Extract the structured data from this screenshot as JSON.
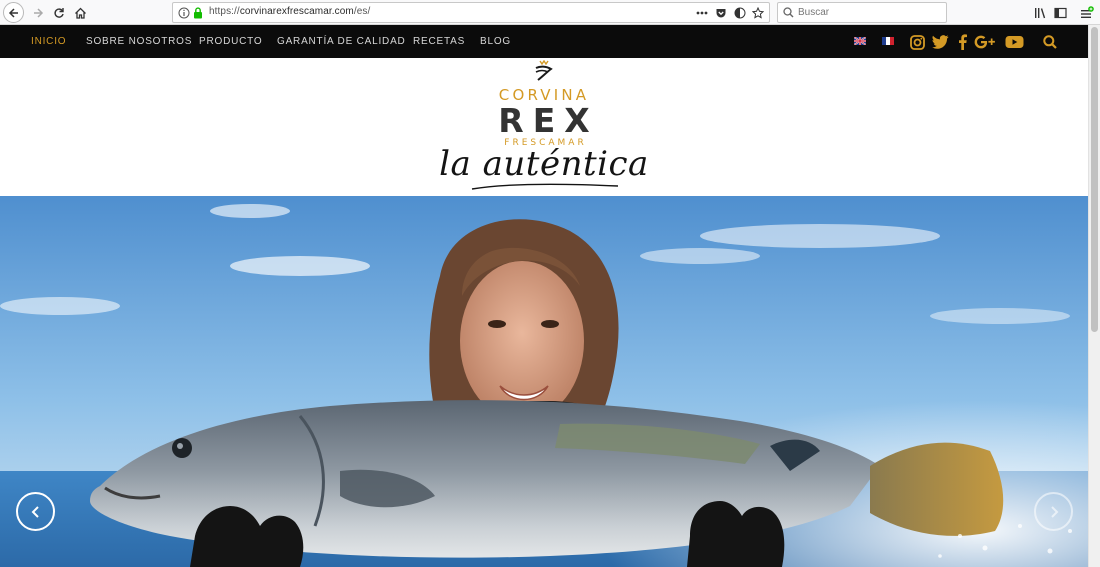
{
  "browser": {
    "url_scheme": "https://",
    "url_host": "corvinarexfrescamar.com",
    "url_path": "/es/",
    "search_placeholder": "Buscar"
  },
  "nav": {
    "items": [
      {
        "label": "INICIO",
        "active": true
      },
      {
        "label": "SOBRE NOSOTROS",
        "active": false
      },
      {
        "label": "PRODUCTO",
        "active": false
      },
      {
        "label": "GARANTÍA DE CALIDAD",
        "active": false
      },
      {
        "label": "RECETAS",
        "active": false
      },
      {
        "label": "BLOG",
        "active": false
      }
    ],
    "languages": [
      "english-flag",
      "french-flag"
    ],
    "social": [
      "instagram-icon",
      "twitter-icon",
      "facebook-icon",
      "google-plus-icon",
      "youtube-icon"
    ],
    "accent_color": "#d49a25"
  },
  "logo": {
    "line1": "CORVINA",
    "line2": "REX",
    "line3": "FRESCAMAR",
    "tagline": "la auténtica"
  },
  "hero": {
    "prev_icon": "chevron-left-icon",
    "next_icon": "chevron-right-icon"
  }
}
